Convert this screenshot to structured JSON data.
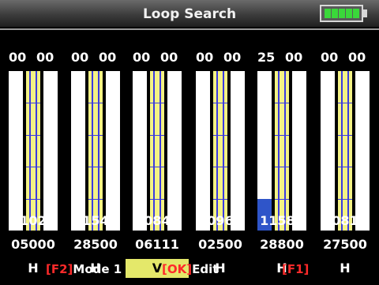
{
  "title": "Loop Search",
  "battery": {
    "level_fraction": 1.0,
    "cells": 5,
    "color": "#3ad83a"
  },
  "colors": {
    "accent_strip": "#f4f384",
    "level_fill": "#2f55c9",
    "selected_mode_bg": "#e4e86a",
    "key_red": "#ff2a2a"
  },
  "channels": [
    {
      "left": "00",
      "right": "00",
      "count": "11021",
      "value": "05000",
      "mode": "H",
      "selected": false,
      "level": 0.0
    },
    {
      "left": "00",
      "right": "00",
      "count": "11549",
      "value": "28500",
      "mode": "H",
      "selected": false,
      "level": 0.0
    },
    {
      "left": "00",
      "right": "00",
      "count": "10848",
      "value": "06111",
      "mode": "V",
      "selected": true,
      "level": 0.0
    },
    {
      "left": "00",
      "right": "00",
      "count": "10967",
      "value": "02500",
      "mode": "H",
      "selected": false,
      "level": 0.0
    },
    {
      "left": "25",
      "right": "00",
      "count": "11589",
      "value": "28800",
      "mode": "H",
      "selected": false,
      "level": 0.2
    },
    {
      "left": "00",
      "right": "00",
      "count": "10815",
      "value": "27500",
      "mode": "H",
      "selected": false,
      "level": 0.0
    }
  ],
  "footer": {
    "f2_key": "[F2]",
    "f2_label": "Mode 1",
    "ok_key": "[OK]",
    "ok_label": "Edit",
    "f1_key": "[F1]",
    "f1_label": ""
  }
}
